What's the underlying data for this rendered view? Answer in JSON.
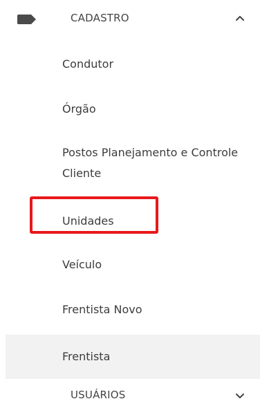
{
  "sections": {
    "cadastro": {
      "title": "CADASTRO",
      "icon": "tag-icon",
      "chevron": "chevron-up-icon",
      "items": [
        {
          "label": "Condutor"
        },
        {
          "label": "Órgão"
        },
        {
          "label": "Postos Planejamento e Controle Cliente"
        },
        {
          "label": "Unidades"
        },
        {
          "label": "Veículo"
        },
        {
          "label": "Frentista Novo"
        },
        {
          "label": "Frentista"
        }
      ]
    },
    "usuarios": {
      "title": "USUÁRIOS",
      "chevron": "chevron-down-icon"
    }
  },
  "colors": {
    "highlight_border": "#e8181b",
    "hover_background": "#f2f2f2",
    "icon": "#4a4a4a",
    "text": "#3c3c3c"
  }
}
